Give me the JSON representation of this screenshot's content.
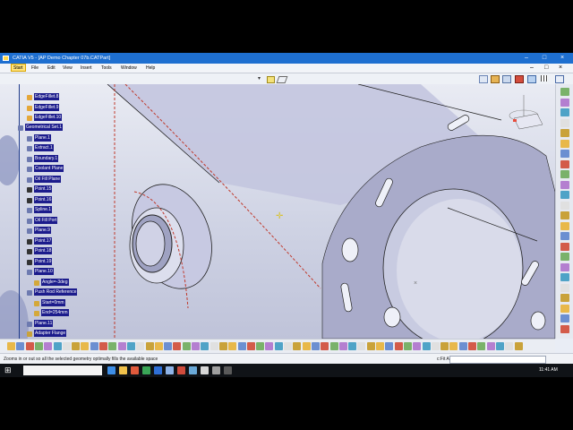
{
  "window": {
    "title": "CATIA V5 - [AP Demo Chapter 07b.CATPart]",
    "controls": [
      "–",
      "□",
      "×"
    ]
  },
  "menu": {
    "items": [
      "Start",
      "File",
      "Edit",
      "View",
      "Insert",
      "Tools",
      "Window",
      "Help"
    ],
    "doc_controls": [
      "–",
      "□",
      "×"
    ]
  },
  "tree": {
    "nodes": [
      "EdgeFillet.8",
      "EdgeFillet.9",
      "EdgeFillet.10",
      "Geometrical Set.1",
      "Plane.1",
      "Extract.1",
      "Boundary.1",
      "Coolant Plane",
      "Oil Fill Plane",
      "Point.15",
      "Point.16",
      "Spline.1",
      "Oil Fill Port",
      "Plane.9",
      "Point.17",
      "Point.18",
      "Point.19",
      "Plane.10",
      "Angle=-3deg",
      "Push Rod Reference",
      "Start=0mm",
      "End=254mm",
      "Plane.11",
      "Adapter Flange"
    ]
  },
  "status": {
    "message": "Zooms in or out so all the selected geometry optimally fills the available space",
    "command_label": "c:Fit All In",
    "command_value": ""
  },
  "taskbar": {
    "search_placeholder": "",
    "clock": "11:41 AM"
  },
  "icons": {
    "toolbar_count": 56,
    "right_count": 24
  }
}
